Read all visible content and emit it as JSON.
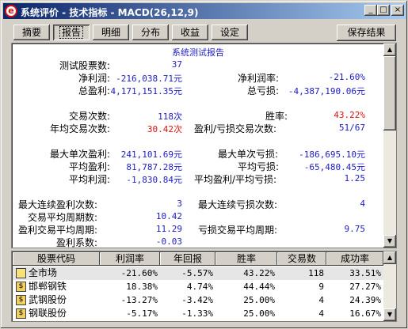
{
  "window": {
    "title": "系统评价 - 技术指标 - MACD(26,12,9)",
    "minimize": "_",
    "maximize": "□",
    "close": "×",
    "app_icon": "e"
  },
  "toolbar": {
    "tabs": [
      "摘要",
      "报告",
      "明细",
      "分布",
      "收益",
      "设定"
    ],
    "active_tab": "报告",
    "save_label": "保存结果"
  },
  "report": {
    "title": "系统测试报告",
    "rows": [
      {
        "label": "测试股票数:",
        "value": "37"
      },
      {
        "label": "净利润:",
        "value": "-216,038.71元",
        "label2": "净利润率:",
        "value2": "-21.60%"
      },
      {
        "label": "总盈利:",
        "value": "4,171,151.35元",
        "label2": "总亏损:",
        "value2": "-4,387,190.06元"
      },
      {
        "label": "交易次数:",
        "value": "118次",
        "label2": "胜率:",
        "value2": "43.22%"
      },
      {
        "label": "年均交易次数:",
        "value": "30.42次",
        "label2": "盈利/亏损交易次数:",
        "value2": "51/67"
      },
      {
        "label": "最大单次盈利:",
        "value": "241,101.69元",
        "label2": "最大单次亏损:",
        "value2": "-186,695.10元"
      },
      {
        "label": "平均盈利:",
        "value": "81,787.28元",
        "label2": "平均亏损:",
        "value2": "-65,480.45元"
      },
      {
        "label": "平均利润:",
        "value": "-1,830.84元",
        "label2": "平均盈利/平均亏损:",
        "value2": "1.25"
      },
      {
        "label": "最大连续盈利次数:",
        "value": "3",
        "label2": "最大连续亏损次数:",
        "value2": "4"
      },
      {
        "label": "交易平均周期数:",
        "value": "10.42"
      },
      {
        "label": "盈利交易平均周期:",
        "value": "11.29",
        "label2": "亏损交易平均周期:",
        "value2": "9.75"
      },
      {
        "label": "盈利系数:",
        "value": "-0.03"
      }
    ]
  },
  "table": {
    "columns": [
      "股票代码",
      "利润率",
      "年回报",
      "胜率",
      "交易数",
      "成功率"
    ],
    "rows": [
      [
        "全市场",
        "-21.60%",
        "-5.57%",
        "43.22%",
        "118",
        "33.51%"
      ],
      [
        "邯郸钢铁",
        "18.38%",
        "4.74%",
        "44.44%",
        "9",
        "27.27%"
      ],
      [
        "武钢股份",
        "-13.27%",
        "-3.42%",
        "25.00%",
        "4",
        "24.39%"
      ],
      [
        "钢联股份",
        "-5.17%",
        "-1.33%",
        "25.00%",
        "4",
        "16.67%"
      ]
    ]
  },
  "colors": {
    "value_blue": "#1c1cc8",
    "highlight_red": "#e01010",
    "titlebar": "#0a246a"
  }
}
